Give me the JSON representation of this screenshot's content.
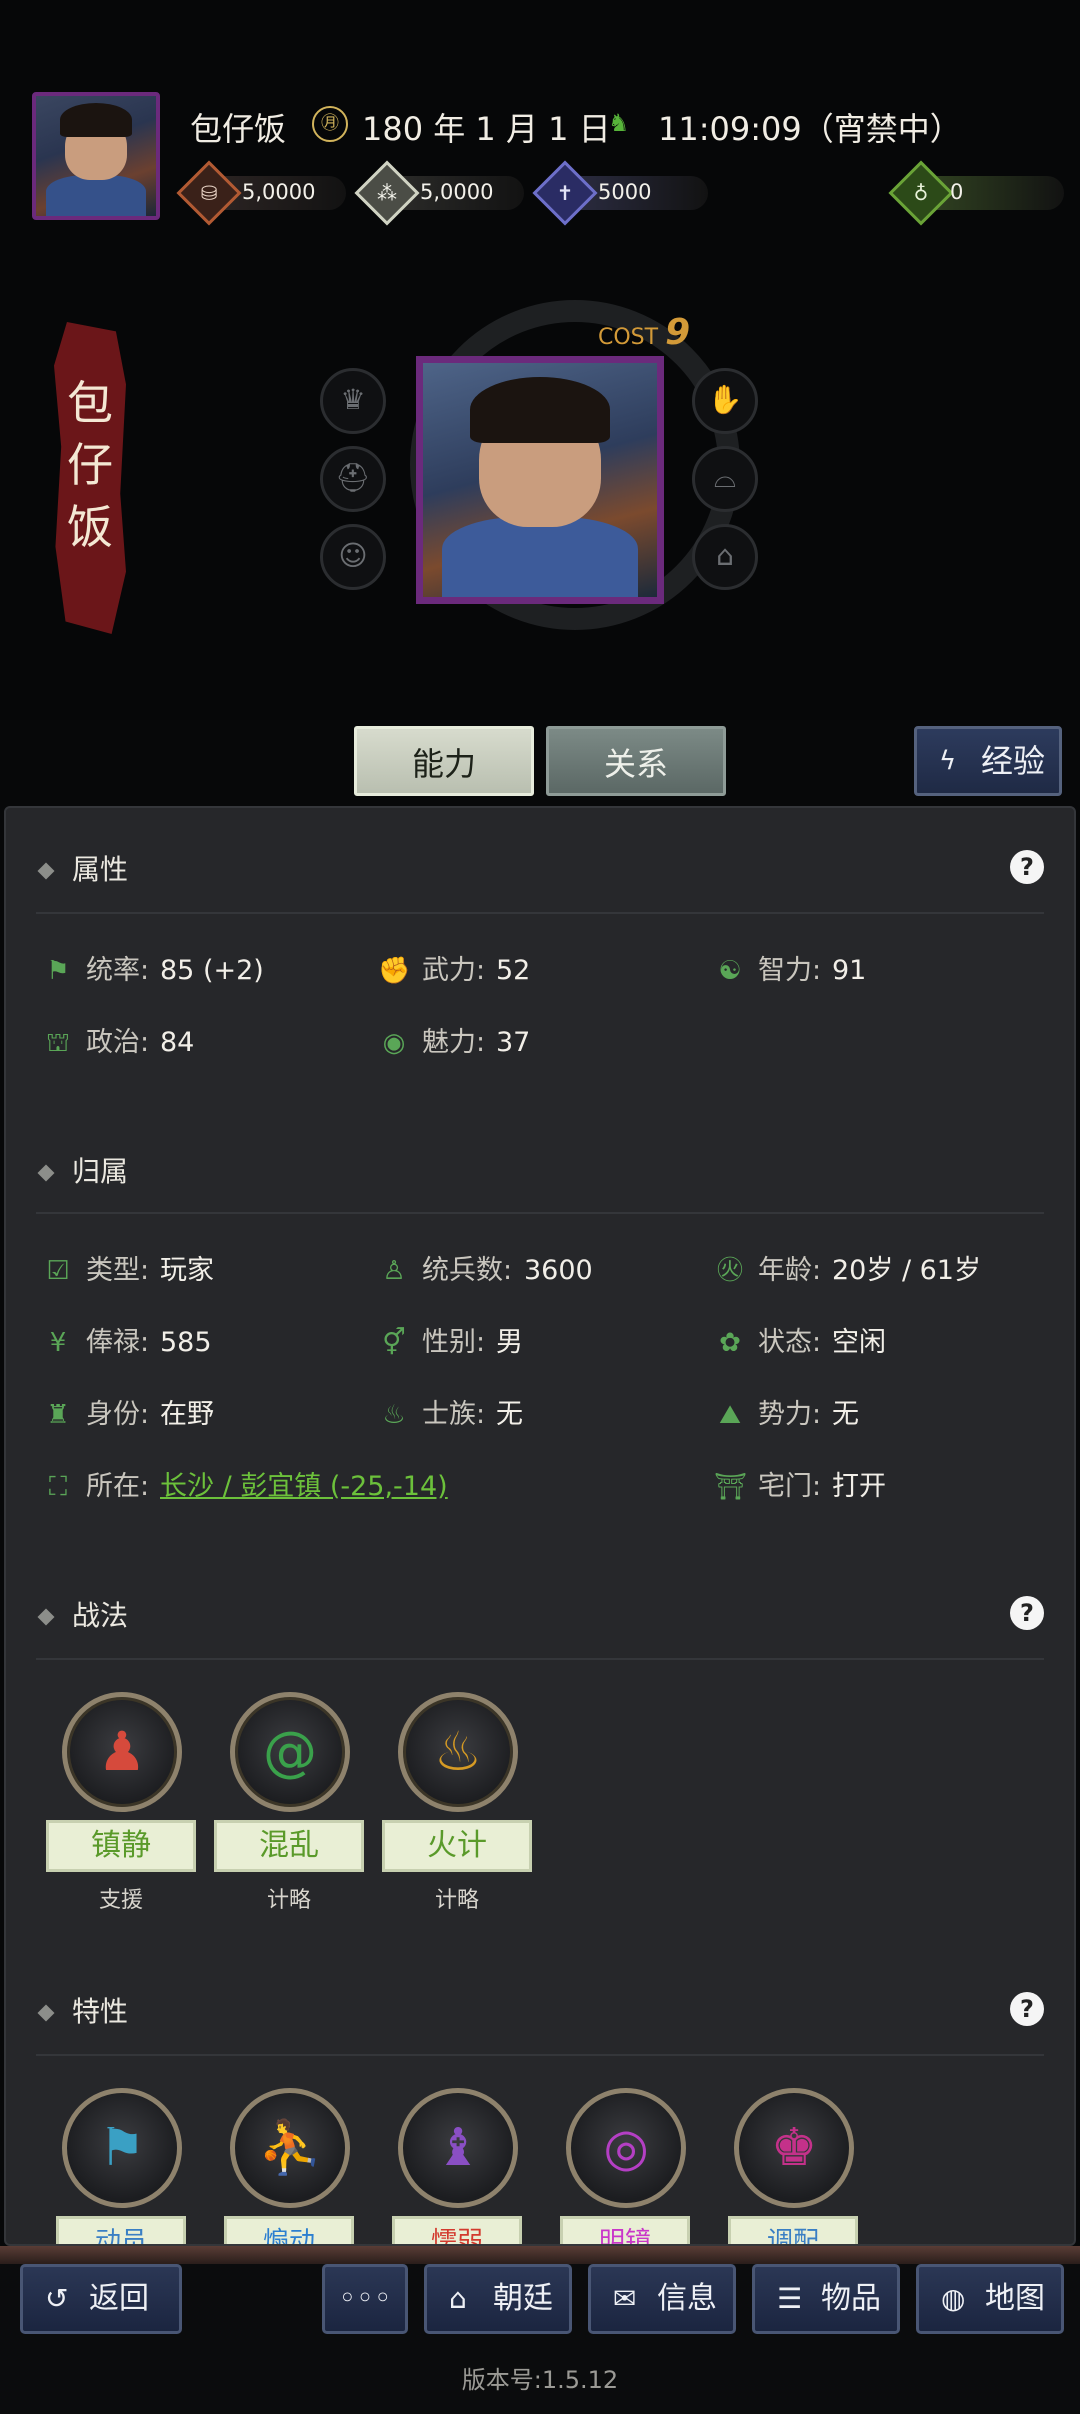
{
  "header": {
    "player_name": "包仔饭",
    "date": "180 年 1 月 1 日",
    "time": "11:09:09（宵禁中）",
    "resources": [
      {
        "icon": "coin-icon",
        "value": "5,0000",
        "color": "#b25a33"
      },
      {
        "icon": "grain-icon",
        "value": "5,0000",
        "color": "#d0d3c3"
      },
      {
        "icon": "soldier-icon",
        "value": "5000",
        "color": "#6d6fc9"
      },
      {
        "icon": "bag-icon",
        "value": "0",
        "color": "#6aa337"
      }
    ]
  },
  "hero": {
    "banner_name": "包\n仔\n饭",
    "cost_label": "COST",
    "cost_value": "9"
  },
  "tabs": {
    "ability": "能力",
    "relation": "关系",
    "experience": "经验"
  },
  "sections": {
    "attributes": {
      "title": "属性",
      "stats": [
        {
          "icon": "flag-icon",
          "label": "统率:",
          "value": "85 (+2)"
        },
        {
          "icon": "arm-icon",
          "label": "武力:",
          "value": "52"
        },
        {
          "icon": "brain-icon",
          "label": "智力:",
          "value": "91"
        },
        {
          "icon": "hat-icon",
          "label": "政治:",
          "value": "84"
        },
        {
          "icon": "eye-icon",
          "label": "魅力:",
          "value": "37"
        }
      ]
    },
    "affiliation": {
      "title": "归属",
      "stats": [
        {
          "icon": "calendar-icon",
          "label": "类型:",
          "value": "玩家"
        },
        {
          "icon": "person-icon",
          "label": "统兵数:",
          "value": "3600"
        },
        {
          "icon": "age-icon",
          "label": "年龄:",
          "value": "20岁 / 61岁"
        },
        {
          "icon": "yen-icon",
          "label": "俸禄:",
          "value": "585"
        },
        {
          "icon": "gender-icon",
          "label": "性别:",
          "value": "男"
        },
        {
          "icon": "status-icon",
          "label": "状态:",
          "value": "空闲"
        },
        {
          "icon": "identity-icon",
          "label": "身份:",
          "value": "在野"
        },
        {
          "icon": "clan-icon",
          "label": "士族:",
          "value": "无"
        },
        {
          "icon": "force-icon",
          "label": "势力:",
          "value": "无"
        },
        {
          "icon": "location-icon",
          "label": "所在:",
          "value": "长沙 / 彭宜镇 (-25,-14)"
        },
        {
          "icon": "gate-icon",
          "label": "宅门:",
          "value": "打开"
        }
      ]
    },
    "tactics": {
      "title": "战法",
      "skills": [
        {
          "icon": "calm-icon",
          "name": "镇静",
          "type": "支援",
          "color": "#d64a3c"
        },
        {
          "icon": "chaos-icon",
          "name": "混乱",
          "type": "计略",
          "color": "#3aa14b"
        },
        {
          "icon": "fire-icon",
          "name": "火计",
          "type": "计略",
          "color": "#d59a24"
        }
      ]
    },
    "traits": {
      "title": "特性",
      "items": [
        {
          "icon": "banner-troops-icon",
          "name": "动员",
          "color": "#3a7fc4"
        },
        {
          "icon": "scholar-icon",
          "name": "煽动",
          "color": "#2c7fd0"
        },
        {
          "icon": "shadow-icon",
          "name": "懦弱",
          "color": "#d33a2e"
        },
        {
          "icon": "mirror-icon",
          "name": "明镜",
          "color": "#c937c9"
        },
        {
          "icon": "people-icon",
          "name": "调配",
          "color": "#3a7fc4"
        }
      ]
    }
  },
  "nav": {
    "back": "返回",
    "more": "◦◦◦",
    "court": "朝廷",
    "info": "信息",
    "items": "物品",
    "map": "地图"
  },
  "version": "版本号:1.5.12"
}
